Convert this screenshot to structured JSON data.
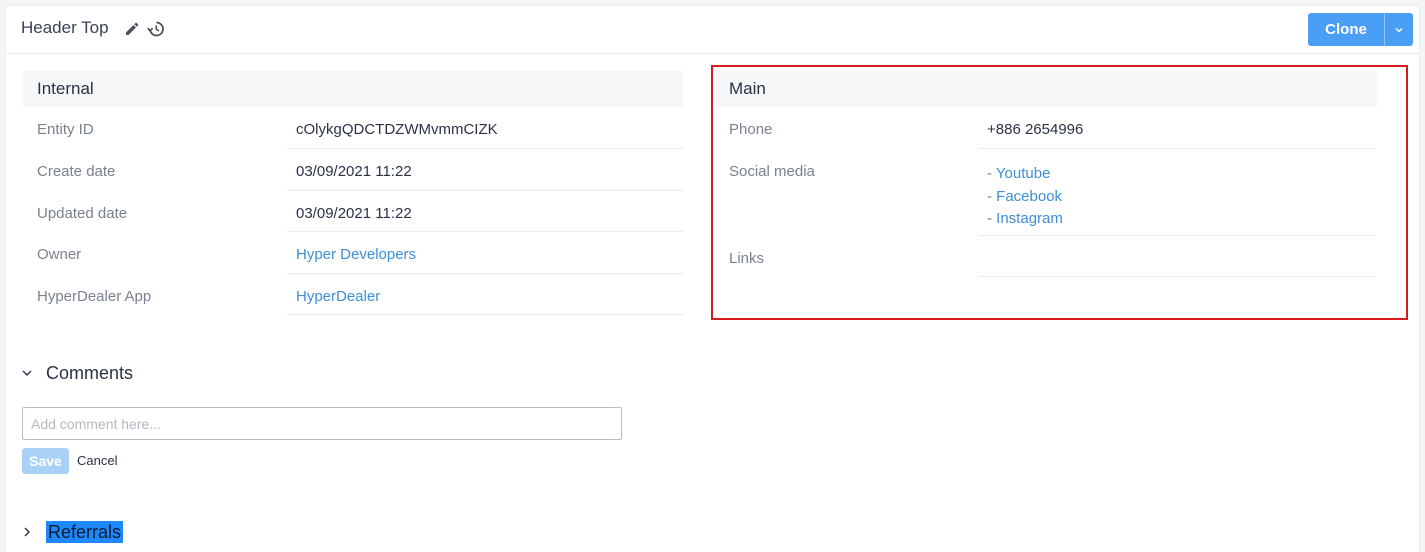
{
  "header": {
    "title": "Header Top",
    "clone_label": "Clone"
  },
  "internal": {
    "heading": "Internal",
    "rows": [
      {
        "label": "Entity ID",
        "value": "cOlykgQDCTDZWMvmmCIZK"
      },
      {
        "label": "Create date",
        "value": "03/09/2021 11:22"
      },
      {
        "label": "Updated date",
        "value": "03/09/2021 11:22"
      },
      {
        "label": "Owner",
        "value": "Hyper Developers"
      },
      {
        "label": "HyperDealer App",
        "value": "HyperDealer"
      }
    ]
  },
  "main": {
    "heading": "Main",
    "phone_label": "Phone",
    "phone_value": "+886 2654996",
    "social_label": "Social media",
    "social_links": [
      "Youtube",
      "Facebook",
      "Instagram"
    ],
    "links_label": "Links"
  },
  "comments": {
    "heading": "Comments",
    "placeholder": "Add comment here...",
    "save_label": "Save",
    "cancel_label": "Cancel"
  },
  "referrals": {
    "heading": "Referrals"
  },
  "colors": {
    "accent": "#4a9ff5",
    "link": "#3d8fd6",
    "highlight": "#d71c1c"
  }
}
